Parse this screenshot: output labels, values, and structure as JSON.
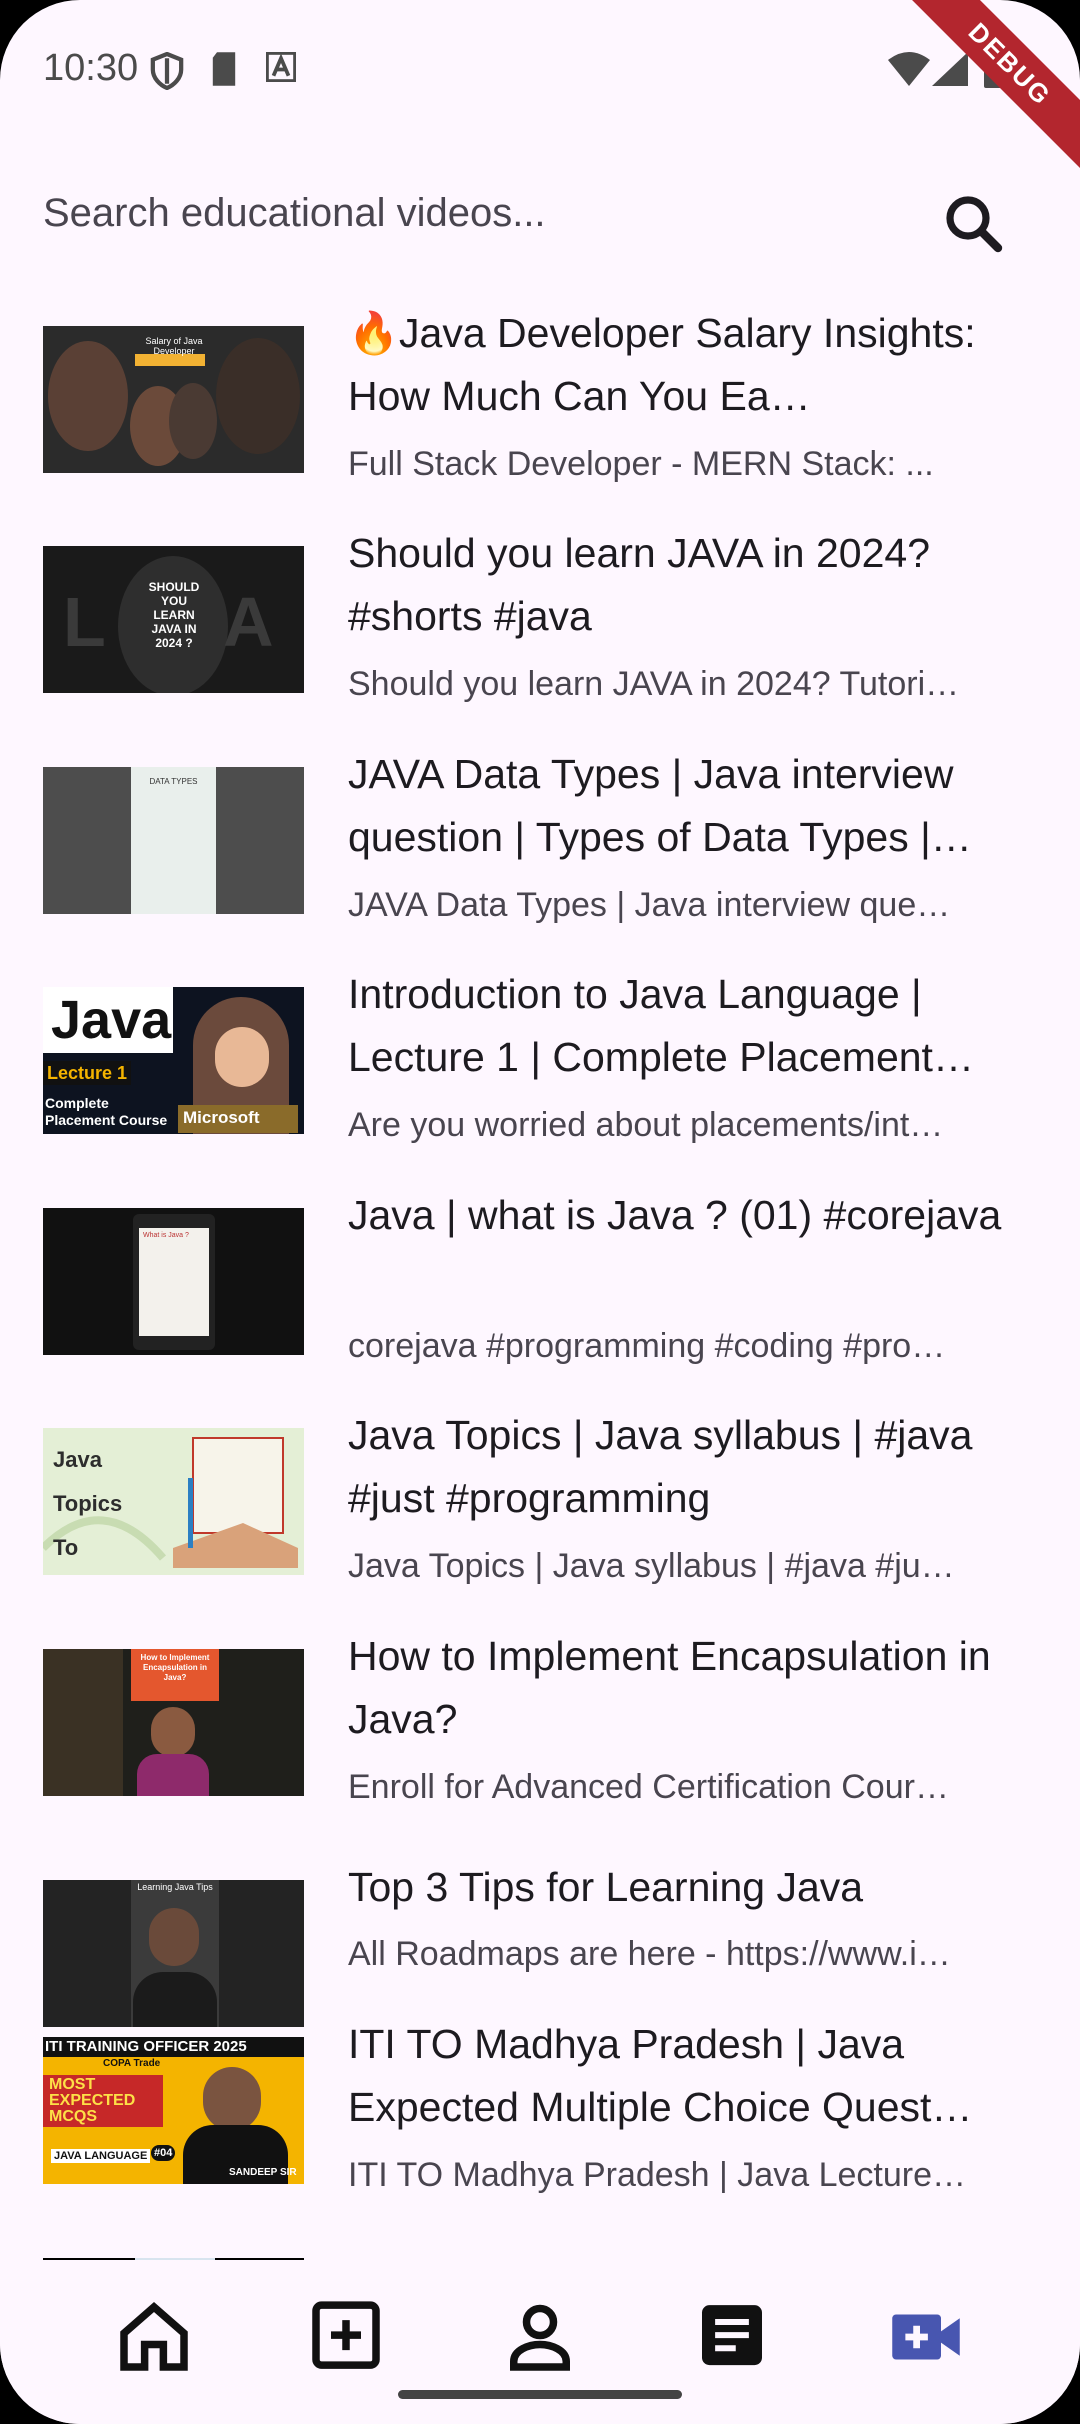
{
  "status_bar": {
    "time": "10:30",
    "debug_label": "DEBUG"
  },
  "search": {
    "placeholder": "Search educational videos...",
    "value": ""
  },
  "videos": [
    {
      "title": "🔥Java Developer Salary Insights: How Much Can You Ea…",
      "subtitle": "Full Stack Developer - MERN Stack: ...",
      "thumb": {
        "caption": "Salary of Java Developer"
      }
    },
    {
      "title": "Should you learn JAVA in 2024? #shorts #java",
      "subtitle": "Should you learn JAVA in 2024? Tutori…",
      "thumb": {
        "caption": "SHOULD YOU LEARN JAVA IN 2024 ?"
      }
    },
    {
      "title": "JAVA Data Types | Java interview question | Types of Data Types |…",
      "subtitle": "JAVA Data Types | Java interview que…",
      "thumb": {
        "caption": "DATA TYPES"
      }
    },
    {
      "title": "Introduction to Java Language | Lecture 1 | Complete Placement…",
      "subtitle": "Are you worried about placements/int…",
      "thumb": {
        "caption": "Java",
        "lecture": "Lecture 1",
        "course": "Complete Placement Course",
        "brand": "Microsoft"
      }
    },
    {
      "title": "Java | what is Java ? (01) #corejava",
      "subtitle": "corejava #programming #coding #pro…",
      "thumb": {
        "caption": "What is Java ?"
      }
    },
    {
      "title": "Java Topics | Java syllabus | #java #just #programming",
      "subtitle": "Java Topics | Java syllabus | #java #ju…",
      "thumb": {
        "caption": "Java Topics To Learn"
      }
    },
    {
      "title": "How to Implement Encapsulation in Java?",
      "subtitle": "Enroll for Advanced Certification Cour…",
      "thumb": {
        "caption": "How to Implement Encapsulation in Java?"
      }
    },
    {
      "title": "Top 3 Tips for Learning Java",
      "subtitle": "All Roadmaps are here - https://www.i…",
      "thumb": {
        "caption": "Learning Java Tips"
      }
    },
    {
      "title": "ITI TO Madhya Pradesh | Java Expected Multiple Choice Quest…",
      "subtitle": "ITI TO Madhya Pradesh | Java Lecture…",
      "thumb": {
        "caption": "ITI TRAINING OFFICER 2025",
        "trade": "COPA Trade",
        "mcq": "MOST EXPECTED MCQS",
        "lang": "JAVA LANGUAGE",
        "episode": "#04",
        "author": "SANDEEP SIR"
      }
    }
  ],
  "nav": {
    "items": [
      {
        "icon": "home-icon"
      },
      {
        "icon": "add-box-icon"
      },
      {
        "icon": "person-icon"
      },
      {
        "icon": "article-icon"
      },
      {
        "icon": "video-call-icon",
        "active": true
      }
    ],
    "active_color": "#4856b0"
  }
}
